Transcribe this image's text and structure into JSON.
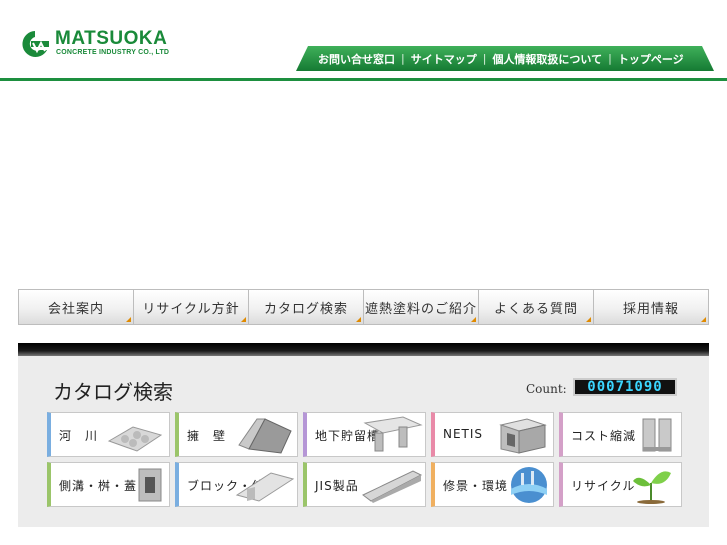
{
  "header": {
    "logo": {
      "name": "MATSUOKA",
      "subtitle": "CONCRETE INDUSTRY CO., LTD"
    },
    "util_links": [
      {
        "label": "お問い合せ窓口"
      },
      {
        "label": "サイトマップ"
      },
      {
        "label": "個人情報取扱について"
      },
      {
        "label": "トップページ"
      }
    ],
    "separator": "|"
  },
  "nav": {
    "items": [
      {
        "label": "会社案内"
      },
      {
        "label": "リサイクル方針"
      },
      {
        "label": "カタログ検索"
      },
      {
        "label": "遮熱塗料のご紹介"
      },
      {
        "label": "よくある質問"
      },
      {
        "label": "採用情報"
      }
    ]
  },
  "catalog": {
    "title": "カタログ検索",
    "count_label": "Count:",
    "count_value": "00071090",
    "tiles": [
      {
        "label": "河　川",
        "accent": "#7aaee0",
        "icon": "river-block-icon"
      },
      {
        "label": "擁　壁",
        "accent": "#9bc56a",
        "icon": "retaining-wall-icon"
      },
      {
        "label": "地下貯留槽",
        "accent": "#b596d6",
        "icon": "storage-tank-icon"
      },
      {
        "label": "NETIS",
        "accent": "#e98aa8",
        "icon": "netis-box-icon"
      },
      {
        "label": "コスト縮減",
        "accent": "#d4a0c8",
        "icon": "u-channel-icon"
      },
      {
        "label": "側溝・桝・蓋",
        "accent": "#9bc56a",
        "icon": "gutter-icon"
      },
      {
        "label": "ブロック・他",
        "accent": "#7aaee0",
        "icon": "block-icon"
      },
      {
        "label": "JIS製品",
        "accent": "#9bc56a",
        "icon": "jis-channel-icon"
      },
      {
        "label": "修景・環境",
        "accent": "#f0b060",
        "icon": "landscape-globe-icon"
      },
      {
        "label": "リサイクル",
        "accent": "#d4a0c8",
        "icon": "sprout-icon"
      }
    ]
  }
}
